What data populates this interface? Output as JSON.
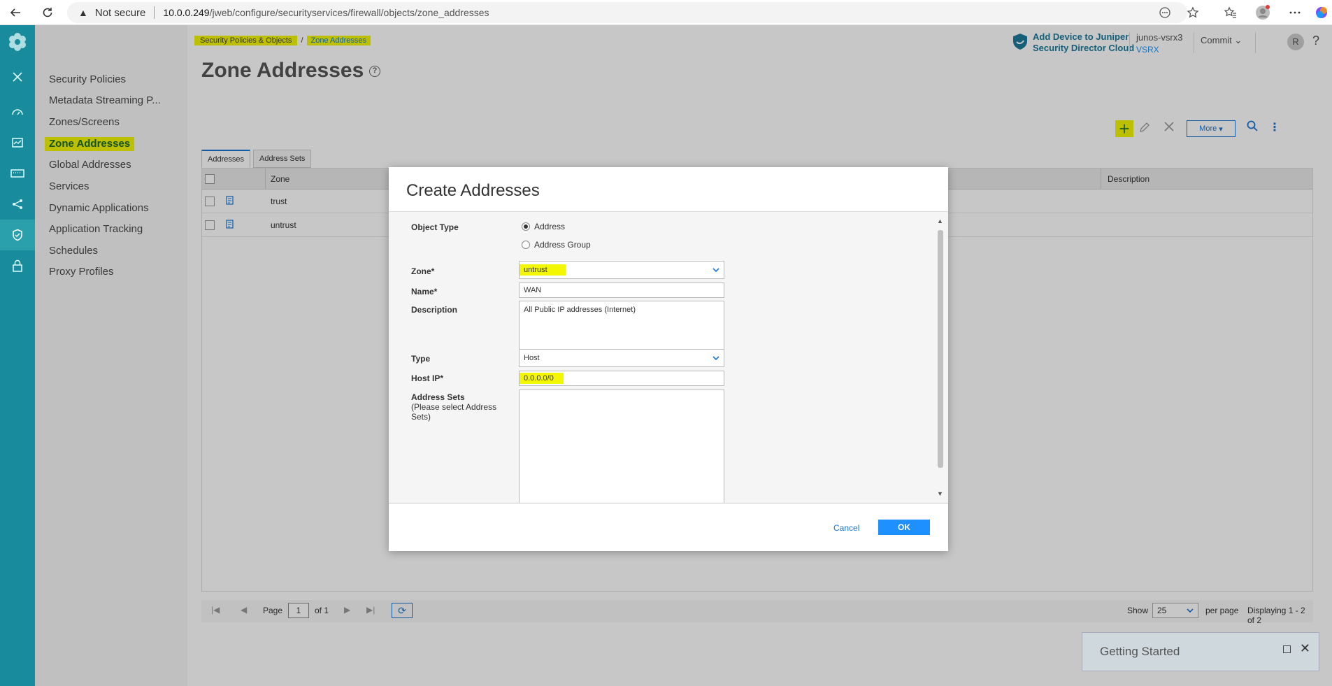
{
  "browser": {
    "security_label": "Not secure",
    "url_host": "10.0.0.249",
    "url_path": "/jweb/configure/securityservices/firewall/objects/zone_addresses"
  },
  "subnav": {
    "items": [
      {
        "label": "Security Policies"
      },
      {
        "label": "Metadata Streaming P..."
      },
      {
        "label": "Zones/Screens"
      },
      {
        "label": "Zone Addresses"
      },
      {
        "label": "Global Addresses"
      },
      {
        "label": "Services"
      },
      {
        "label": "Dynamic Applications"
      },
      {
        "label": "Application Tracking"
      },
      {
        "label": "Schedules"
      },
      {
        "label": "Proxy Profiles"
      }
    ]
  },
  "breadcrumb": {
    "parent": "Security Policies & Objects",
    "separator": "/",
    "current": "Zone Addresses"
  },
  "page": {
    "title": "Zone Addresses",
    "help": "?"
  },
  "header": {
    "sd_line1": "Add Device to Juniper",
    "sd_line2": "Security Director Cloud",
    "device_name": "junos-vsrx3",
    "device_model": "VSRX",
    "commit": "Commit",
    "user_initial": "R",
    "help": "?"
  },
  "toolbar": {
    "more": "More"
  },
  "tabs": [
    {
      "label": "Addresses"
    },
    {
      "label": "Address Sets"
    }
  ],
  "grid": {
    "columns": {
      "zone": "Zone",
      "description": "Description"
    },
    "rows": [
      {
        "zone": "trust"
      },
      {
        "zone": "untrust"
      }
    ]
  },
  "footer": {
    "page_label": "Page",
    "page_value": "1",
    "of_label": "of 1",
    "show_label": "Show",
    "per_page_value": "25",
    "per_page_label": "per page",
    "displaying": "Displaying 1 - 2 of 2"
  },
  "modal": {
    "title": "Create Addresses",
    "object_type_label": "Object Type",
    "object_type_options": [
      "Address",
      "Address Group"
    ],
    "zone_label": "Zone*",
    "zone_value": "untrust",
    "name_label": "Name*",
    "name_value": "WAN",
    "description_label": "Description",
    "description_value": "All Public IP addresses (Internet)",
    "type_label": "Type",
    "type_value": "Host",
    "host_ip_label": "Host IP*",
    "host_ip_value": "0.0.0.0/0",
    "address_sets_label": "Address Sets",
    "address_sets_hint": "(Please select Address Sets)",
    "cancel": "Cancel",
    "ok": "OK"
  },
  "getting_started": {
    "title": "Getting Started"
  },
  "colors": {
    "rail": "#188c9c",
    "accent": "#1976d2",
    "highlight": "#f3f700",
    "ok_button": "#1e90ff"
  }
}
